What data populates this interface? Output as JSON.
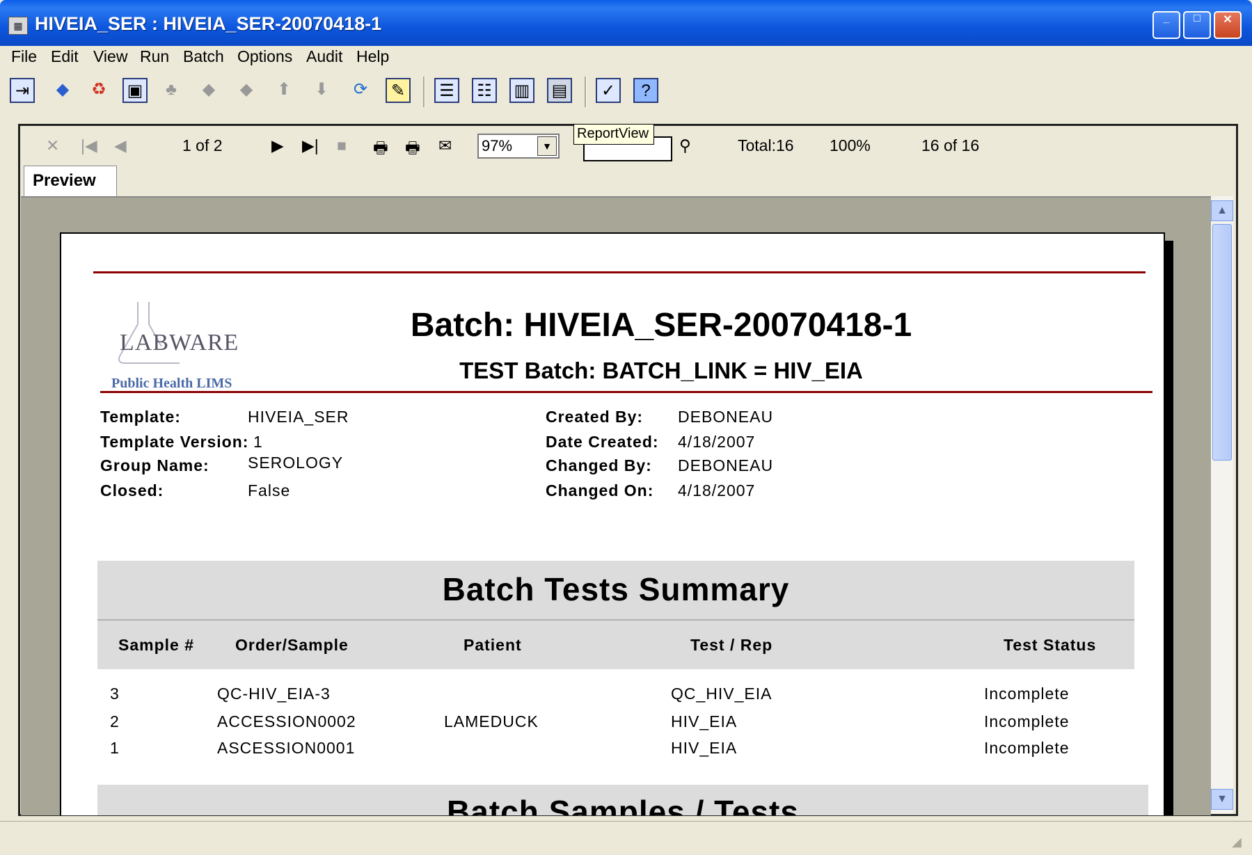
{
  "window": {
    "title": "HIVEIA_SER : HIVEIA_SER-20070418-1",
    "minimize": "_",
    "maximize": "□",
    "close": "✕"
  },
  "menu": [
    "File",
    "Edit",
    "View",
    "Run",
    "Batch",
    "Options",
    "Audit",
    "Help"
  ],
  "report_toolbar": {
    "page_indicator": "1 of 2",
    "zoom": "97%",
    "total": "Total:16",
    "percent": "100%",
    "count": "16 of 16"
  },
  "tooltip": "ReportView",
  "tab": "Preview",
  "report": {
    "logo_text": "LABWARE",
    "logo_sub": "Public Health LIMS",
    "title": "Batch: HIVEIA_SER-20070418-1",
    "subtitle": "TEST Batch: BATCH_LINK = HIV_EIA",
    "fields_left": [
      {
        "label": "Template:",
        "value": "HIVEIA_SER"
      },
      {
        "label": "Template Version:",
        "value": "1"
      },
      {
        "label": "Group Name:",
        "value": "SEROLOGY"
      },
      {
        "label": "Closed:",
        "value": "False"
      }
    ],
    "fields_right": [
      {
        "label": "Created By:",
        "value": "DEBONEAU"
      },
      {
        "label": "Date Created:",
        "value": "4/18/2007"
      },
      {
        "label": "Changed By:",
        "value": "DEBONEAU"
      },
      {
        "label": "Changed On:",
        "value": "4/18/2007"
      }
    ],
    "summary_title": "Batch Tests Summary",
    "columns": [
      "Sample #",
      "Order/Sample",
      "Patient",
      "Test / Rep",
      "Test Status"
    ],
    "rows": [
      [
        "3",
        "QC-HIV_EIA-3",
        "",
        "QC_HIV_EIA",
        "Incomplete"
      ],
      [
        "2",
        "ACCESSION0002",
        "LAMEDUCK",
        "HIV_EIA",
        "Incomplete"
      ],
      [
        "1",
        "ASCESSION0001",
        "",
        "HIV_EIA",
        "Incomplete"
      ]
    ],
    "next_section_title": "Batch Samples / Tests"
  }
}
